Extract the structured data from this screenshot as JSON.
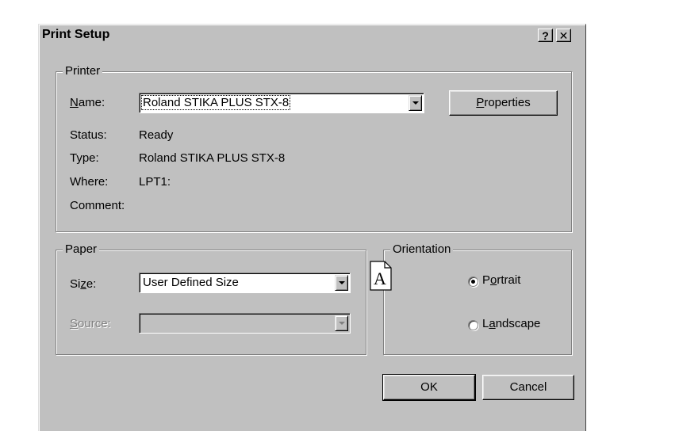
{
  "dialog": {
    "title": "Print Setup",
    "help_label": "?",
    "close_label": "✕"
  },
  "printer": {
    "group_label": "Printer",
    "name_label_underlined": "N",
    "name_label_rest": "ame:",
    "name_value": "Roland STIKA PLUS STX-8",
    "properties_underlined": "P",
    "properties_rest": "roperties",
    "status_label": "Status:",
    "status_value": "Ready",
    "type_label": "Type:",
    "type_value": "Roland STIKA PLUS STX-8",
    "where_label": "Where:",
    "where_value": "LPT1:",
    "comment_label": "Comment:",
    "comment_value": ""
  },
  "paper": {
    "group_label": "Paper",
    "size_label_pre": "Si",
    "size_label_underlined": "z",
    "size_label_post": "e:",
    "size_value": "User Defined Size",
    "source_label_underlined": "S",
    "source_label_rest": "ource:",
    "source_value": ""
  },
  "orientation": {
    "group_label": "Orientation",
    "icon_letter": "A",
    "portrait_pre": "P",
    "portrait_underlined": "o",
    "portrait_post": "rtrait",
    "portrait_checked": true,
    "landscape_pre": "L",
    "landscape_underlined": "a",
    "landscape_post": "ndscape",
    "landscape_checked": false
  },
  "buttons": {
    "ok_label": "OK",
    "cancel_label": "Cancel"
  }
}
